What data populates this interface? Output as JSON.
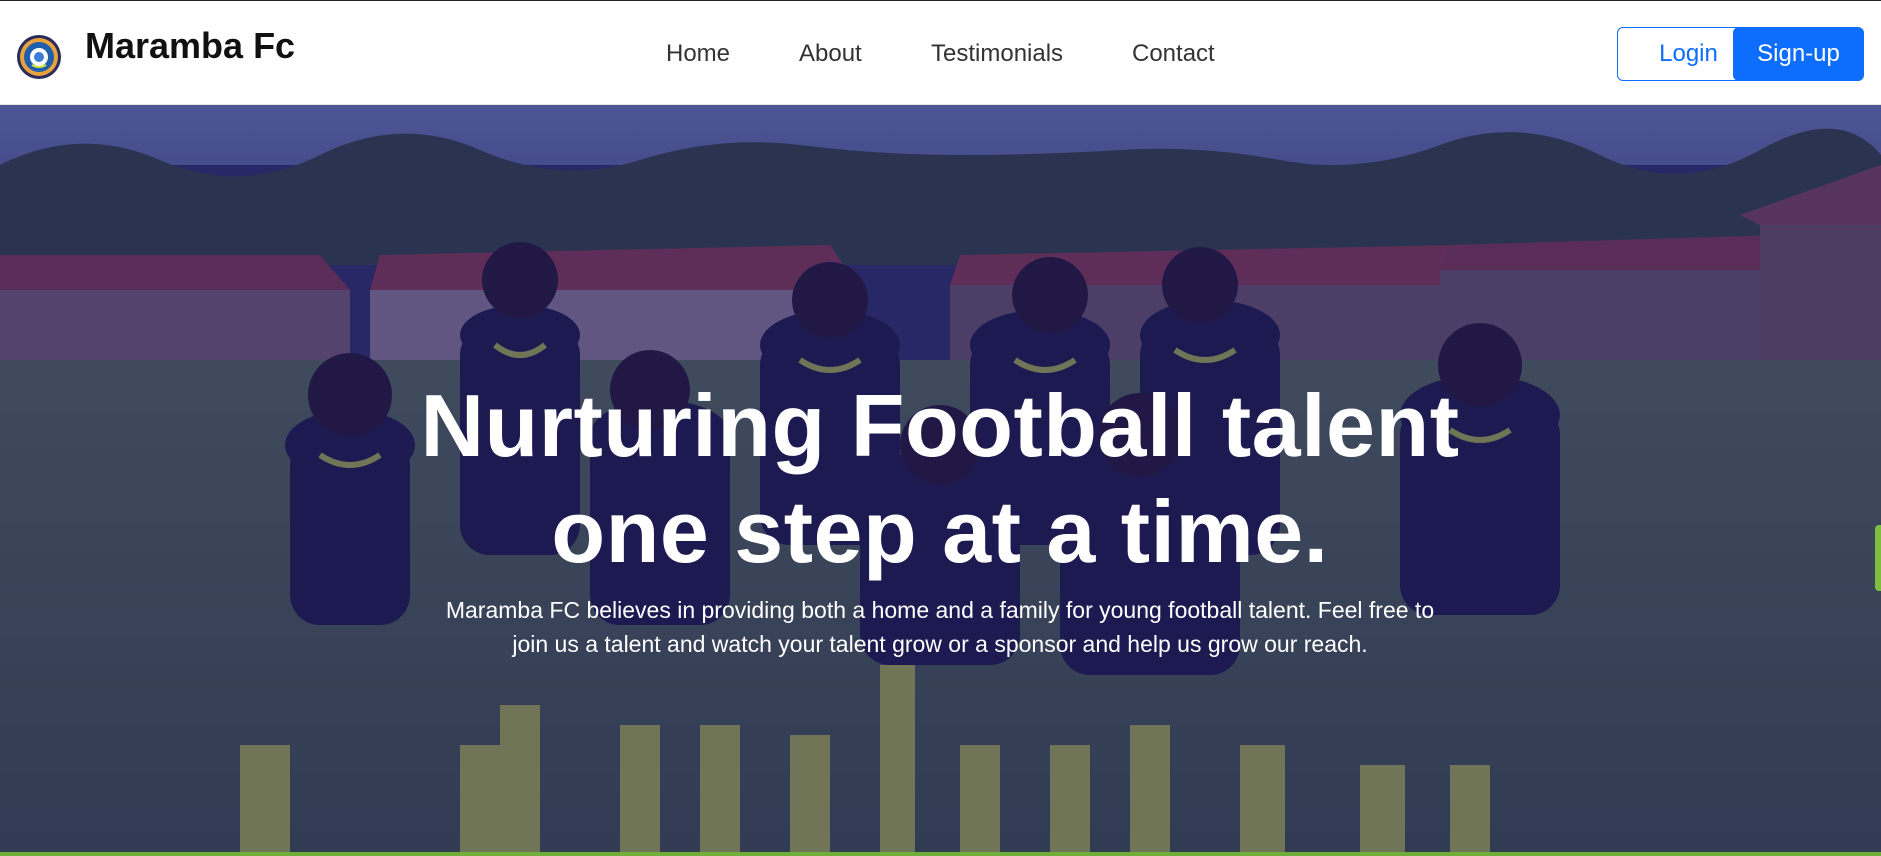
{
  "brand": {
    "name": "Maramba Fc",
    "logo_icon": "club-crest-icon"
  },
  "nav": {
    "links": [
      {
        "label": "Home"
      },
      {
        "label": "About"
      },
      {
        "label": "Testimonials"
      },
      {
        "label": "Contact"
      }
    ]
  },
  "auth": {
    "login_label": "Login",
    "signup_label": "Sign-up"
  },
  "hero": {
    "title_line1": "Nurturing Football talent",
    "title_line2": "one step at a time.",
    "description_line1": "Maramba FC believes in providing both a home and a family for young football talent. Feel free to",
    "description_line2": "join us a talent and watch your talent grow or a sponsor and help us grow our reach.",
    "background_image": "team-photo"
  },
  "colors": {
    "primary": "#0d6efd",
    "overlay": "#1a166e",
    "jersey_accent": "#d7e83a"
  }
}
